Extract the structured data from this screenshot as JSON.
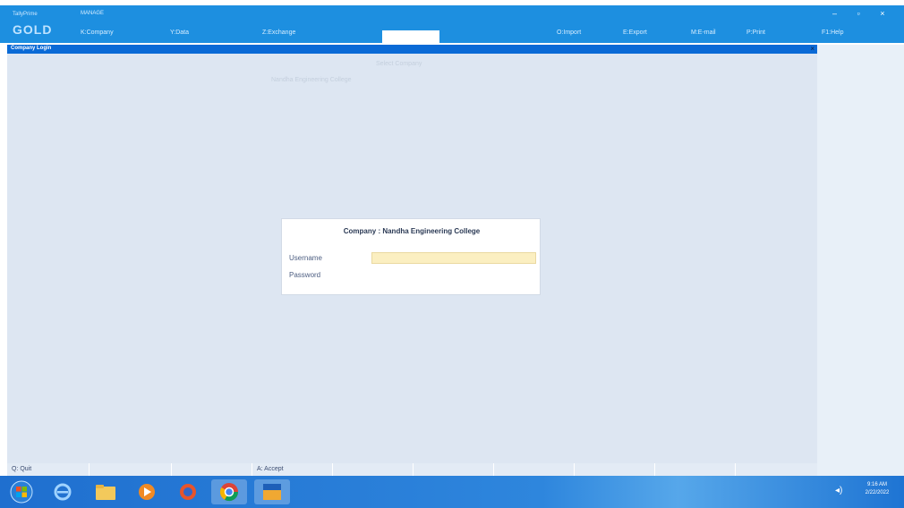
{
  "app": {
    "brand_top": "TallyPrime",
    "brand_name": "GOLD",
    "sub_label": "MANAGE"
  },
  "menu": {
    "company": "K:Company",
    "data": "Y:Data",
    "exchange": "Z:Exchange",
    "import": "O:Import",
    "export": "E:Export",
    "email": "M:E-mail",
    "print": "P:Print",
    "help": "F1:Help"
  },
  "window_controls": {
    "minimize": "–",
    "restore": "▫",
    "close": "×"
  },
  "screen": {
    "title": "Company Login",
    "faint_heading": "Select Company",
    "faint_item": "Nandha Engineering College"
  },
  "login": {
    "title": "Company : Nandha Engineering College",
    "username_label": "Username",
    "password_label": "Password",
    "username_value": ""
  },
  "footer": {
    "quit": "Q: Quit",
    "accept": "A: Accept"
  },
  "taskbar": {
    "time": "9:16 AM",
    "date": "2/22/2022"
  }
}
